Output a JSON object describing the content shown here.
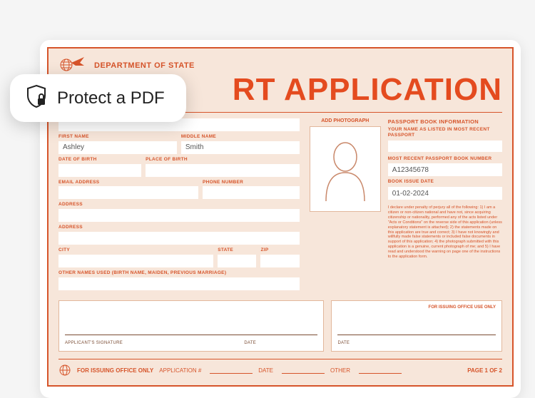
{
  "pill": {
    "label": "Protect a PDF"
  },
  "doc": {
    "department": "DEPARTMENT OF STATE",
    "title": "RT APPLICATION",
    "left": {
      "first_name_label": "FIRST NAME",
      "first_name_value": "Ashley",
      "middle_name_label": "MIDDLE NAME",
      "middle_name_value": "Smith",
      "dob_label": "DATE OF BIRTH",
      "pob_label": "PLACE OF BIRTH",
      "email_label": "EMAIL ADDRESS",
      "phone_label": "PHONE NUMBER",
      "address_label": "ADDRESS",
      "address2_label": "ADDRESS",
      "city_label": "CITY",
      "state_label": "STATE",
      "zip_label": "ZIP",
      "other_names_label": "OTHER NAMES USED (BIRTH NAME, MAIDEN, PREVIOUS MARRIAGE)"
    },
    "right": {
      "add_photo_label": "ADD PHOTOGRAPH",
      "section_title": "PASSPORT BOOK INFORMATION",
      "name_listed_label": "YOUR NAME AS LISTED IN MOST RECENT PASSPORT",
      "book_number_label": "MOST RECENT PASSPORT BOOK NUMBER",
      "book_number_value": "A12345678",
      "issue_date_label": "BOOK ISSUE DATE",
      "issue_date_value": "01-02-2024",
      "fine_print": "I declare under penalty of perjury all of the following: 1) I am a citizen or non-citizen national and have not, since acquiring citizenship or nationality, performed any of the acts listed under \"Acts or Conditions\" on the reverse side of this application (unless explanatory statement is attached); 2) the statements made on this application are true and correct; 3) I have not knowingly and willfully made false statements or included false documents in support of this application; 4) the photograph submitted with this application is a genuine, current photograph of me; and 5) I have read and understood the warning on page one of the instructions to the application form."
    },
    "sig": {
      "applicant": "APPLICANT'S SIGNATURE",
      "date": "DATE",
      "office": "FOR ISSUING OFFICE USE ONLY"
    },
    "footer": {
      "office_only": "FOR ISSUING OFFICE ONLY",
      "app_no": "APPLICATION #",
      "date": "DATE",
      "other": "OTHER",
      "page": "PAGE 1 OF 2"
    }
  }
}
